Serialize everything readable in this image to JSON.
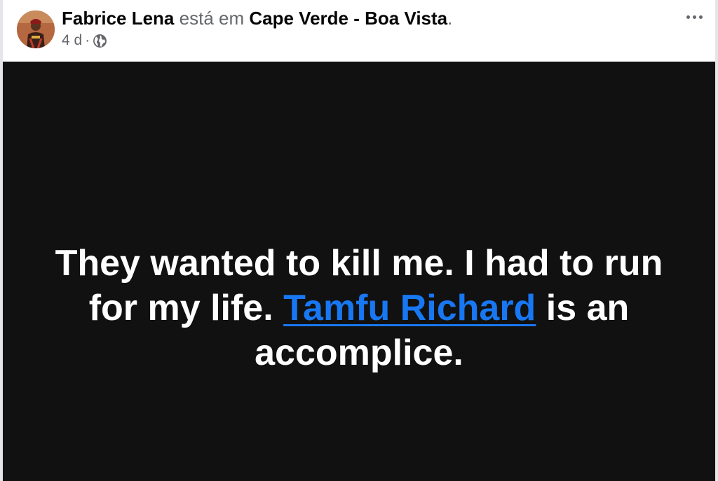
{
  "header": {
    "author": "Fabrice Lena",
    "connector": "está em",
    "location": "Cape Verde - Boa Vista",
    "period": ".",
    "time": "4 d",
    "separator": "·",
    "audience_icon": "globe-icon",
    "menu_icon": "more-options-icon"
  },
  "post": {
    "background": "#111111",
    "text_before": "They wanted to kill me. I had to run for my life.",
    "mention": "Tamfu Richard",
    "text_after": "is an accomplice."
  },
  "colors": {
    "mention": "#1877f2",
    "text": "#ffffff",
    "secondary": "#65676b"
  }
}
